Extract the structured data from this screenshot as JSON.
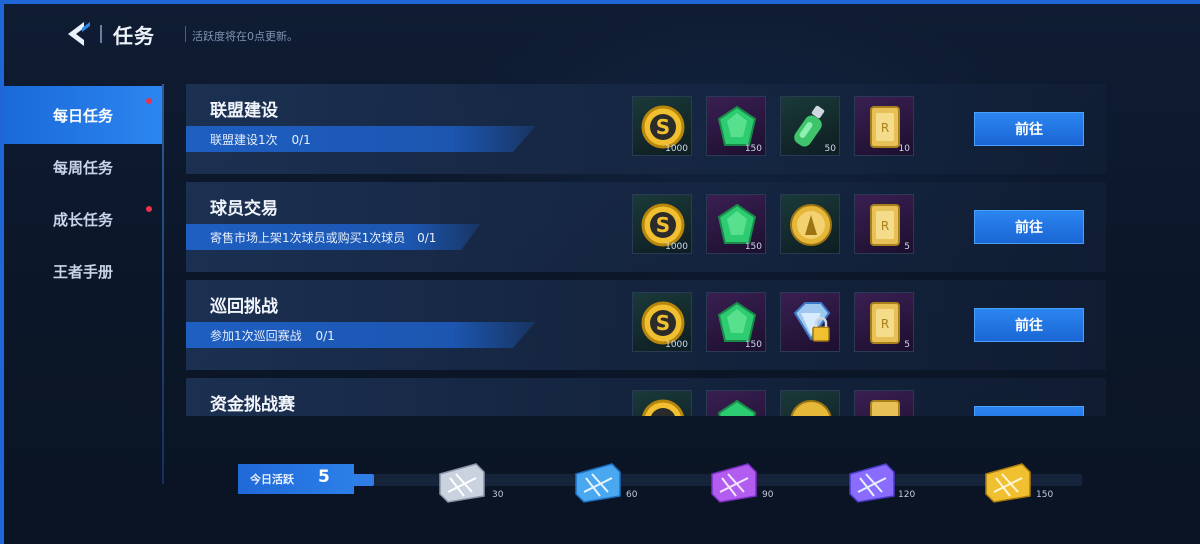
{
  "header": {
    "title": "任务",
    "note": "活跃度将在0点更新。"
  },
  "sidebar": {
    "items": [
      {
        "label": "每日任务",
        "active": true,
        "has_dot": true
      },
      {
        "label": "每周任务",
        "active": false,
        "has_dot": false
      },
      {
        "label": "成长任务",
        "active": false,
        "has_dot": true
      },
      {
        "label": "王者手册",
        "active": false,
        "has_dot": false
      }
    ]
  },
  "tasks": [
    {
      "name": "联盟建设",
      "desc": "联盟建设1次",
      "progress": "0/1",
      "go_label": "前往",
      "rewards": [
        {
          "icon": "gold-coin-icon",
          "qty": "1000"
        },
        {
          "icon": "green-gem-icon",
          "qty": "150"
        },
        {
          "icon": "green-bottle-icon",
          "qty": "50"
        },
        {
          "icon": "gold-card-icon",
          "qty": "10"
        }
      ]
    },
    {
      "name": "球员交易",
      "desc": "寄售市场上架1次球员或购买1次球员",
      "progress": "0/1",
      "go_label": "前往",
      "rewards": [
        {
          "icon": "gold-coin-icon",
          "qty": "1000"
        },
        {
          "icon": "green-gem-icon",
          "qty": "150"
        },
        {
          "icon": "gold-medal-icon",
          "qty": ""
        },
        {
          "icon": "gold-card-icon",
          "qty": "5"
        }
      ]
    },
    {
      "name": "巡回挑战",
      "desc": "参加1次巡回赛战",
      "progress": "0/1",
      "go_label": "前往",
      "rewards": [
        {
          "icon": "gold-coin-icon",
          "qty": "1000"
        },
        {
          "icon": "green-gem-icon",
          "qty": "150"
        },
        {
          "icon": "locked-diamond-icon",
          "qty": ""
        },
        {
          "icon": "gold-card-icon",
          "qty": "5"
        }
      ]
    },
    {
      "name": "资金挑战赛",
      "desc": "",
      "progress": "",
      "go_label": "",
      "rewards": [
        {
          "icon": "gold-coin-icon",
          "qty": ""
        },
        {
          "icon": "green-gem-icon",
          "qty": ""
        },
        {
          "icon": "gold-medal-icon",
          "qty": ""
        },
        {
          "icon": "gold-card-icon",
          "qty": ""
        }
      ]
    }
  ],
  "activity": {
    "label": "今日活跃",
    "value": "5",
    "progress_fraction": 0.03,
    "chests": [
      {
        "threshold": "30",
        "color": "#c9d2de"
      },
      {
        "threshold": "60",
        "color": "#4aa8f0"
      },
      {
        "threshold": "90",
        "color": "#b35cf0"
      },
      {
        "threshold": "120",
        "color": "#8a6cff"
      },
      {
        "threshold": "150",
        "color": "#f0c030"
      }
    ]
  },
  "colors": {
    "accent": "#2c86f0",
    "notification_dot": "#e8334a"
  }
}
